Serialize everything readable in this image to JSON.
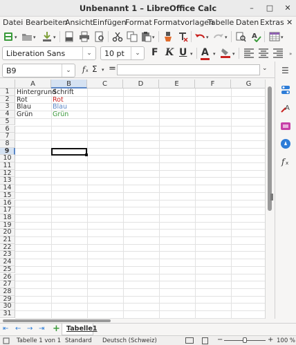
{
  "window": {
    "title": "Unbenannt 1 – LibreOffice Calc",
    "buttons": {
      "minimize": "–",
      "maximize": "□",
      "close": "✕"
    }
  },
  "menu": {
    "items": [
      "Datei",
      "Bearbeiten",
      "Ansicht",
      "Einfügen",
      "Format",
      "Formatvorlagen",
      "Tabelle",
      "Daten",
      "Extras"
    ],
    "close_doc": "✕"
  },
  "toolbar": {
    "icons": [
      "new-document-icon",
      "open-icon",
      "save-icon",
      "export-pdf-icon",
      "print-icon",
      "print-preview-icon",
      "cut-icon",
      "copy-icon",
      "paste-icon",
      "clone-formatting-icon",
      "clear-formatting-icon",
      "undo-icon",
      "redo-icon",
      "find-replace-icon",
      "spellcheck-icon",
      "insert-table-icon"
    ]
  },
  "formatting": {
    "font_name": "Liberation Sans",
    "font_size": "10 pt",
    "bold": "F",
    "italic": "K",
    "underline": "U",
    "font_color_letter": "A",
    "font_color": "#c9211e",
    "highlight_color": "#c9211e"
  },
  "formula_bar": {
    "name_box": "B9",
    "function_wizard": "f",
    "sum": "Σ",
    "equals": "=",
    "input_value": ""
  },
  "sheet": {
    "columns": [
      "A",
      "B",
      "C",
      "D",
      "E",
      "F",
      "G"
    ],
    "selected_column": "B",
    "selected_row": "9",
    "rows": [
      "1",
      "2",
      "3",
      "4",
      "5",
      "6",
      "7",
      "8",
      "9",
      "10",
      "11",
      "12",
      "13",
      "14",
      "15",
      "16",
      "17",
      "18",
      "19",
      "20",
      "21",
      "22",
      "23",
      "24",
      "25",
      "26",
      "27",
      "28",
      "29",
      "30",
      "31"
    ],
    "cells": {
      "A1": "Hintergrund",
      "B1": "Schrift",
      "A2": "Rot",
      "B2": "Rot",
      "A3": "Blau",
      "B3": "Blau",
      "A4": "Grün",
      "B4": "Grün"
    },
    "cell_colors": {
      "B2": "#c9211e",
      "B3": "#5b87c6",
      "B4": "#3d9a3d"
    }
  },
  "sheet_tabs": {
    "nav": [
      "⇤",
      "←",
      "→",
      "⇥"
    ],
    "add": "+",
    "active_tab": "Tabelle1"
  },
  "status_bar": {
    "sheet_info": "Tabelle 1 von 1",
    "page_style": "Standard",
    "language": "Deutsch (Schweiz)",
    "zoom_out": "−",
    "zoom_in": "+",
    "zoom": "100 %"
  }
}
